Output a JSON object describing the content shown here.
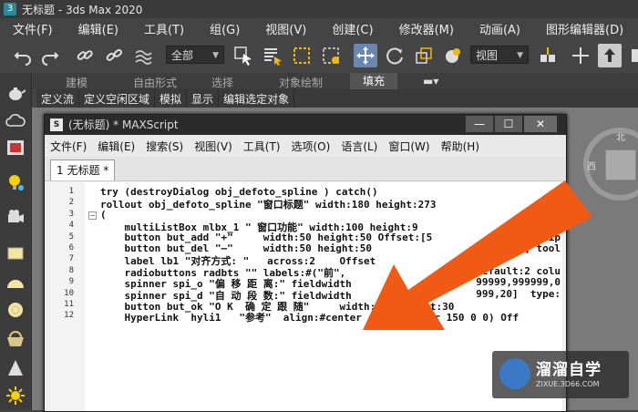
{
  "app": {
    "title": "无标题 - 3ds Max 2020",
    "logo_label": "3"
  },
  "main_menu": [
    "文件(F)",
    "编辑(E)",
    "工具(T)",
    "组(G)",
    "视图(V)",
    "创建(C)",
    "修改器(M)",
    "动画(A)",
    "图形编辑器(D)"
  ],
  "toolbar": {
    "selection_filter": "全部",
    "view_combo": "视图"
  },
  "ribbon": {
    "tabs": [
      "建模",
      "自由形式",
      "选择",
      "对象绘制",
      "填充"
    ],
    "active_tab": "填充",
    "sub_items": [
      "定义流",
      "定义空闲区域",
      "模拟",
      "显示",
      "编辑选定对象"
    ]
  },
  "viewcube": {
    "north": "北",
    "west": "西"
  },
  "maxscript": {
    "title": "(无标题) * MAXScript",
    "icon_label": "S",
    "window_buttons": [
      "—",
      "☐",
      "✕"
    ],
    "menu": [
      "文件(F)",
      "编辑(E)",
      "搜索(S)",
      "视图(V)",
      "工具(T)",
      "选项(O)",
      "语言(L)",
      "窗口(W)",
      "帮助(H)"
    ],
    "tab": "1 无标题 *",
    "lines": [
      {
        "num": "1",
        "code": "try (destroyDialog obj_defoto_spline ) catch()"
      },
      {
        "num": "2",
        "code": "rollout obj_defoto_spline \"窗口标题\" width:180 height:273"
      },
      {
        "num": "3",
        "code": "("
      },
      {
        "num": "4",
        "code": "    multiListBox mlbx_1 \" 窗口功能\" width:100 height:9"
      },
      {
        "num": "5",
        "code": "    button but_add \"+\"     width:50 height:50 Offset:[5"
      },
      {
        "num": "6",
        "code": "    button but_del \"—\"     width:50 height:50"
      },
      {
        "num": "7",
        "code": "    label lb1 \"对齐方式: \"   across:2    Offset"
      },
      {
        "num": "8",
        "code": "    radiobuttons radbts \"\" labels:#(\"前\","
      },
      {
        "num": "9",
        "code": "    spinner spi_o \"偏 移 距 离:\" fieldwidth"
      },
      {
        "num": "10",
        "code": "    spinner spi_d \"自 动 段 数:\" fieldwidth"
      },
      {
        "num": "11",
        "code": "    button but_ok \"O K  确 定 跟 随\"     width:150 height:30"
      },
      {
        "num": "12",
        "code": "    HyperLink  hyli1   \"参考\"  align:#center color:(color 150 0 0) Off"
      }
    ],
    "right_fragments": [
      {
        "line": 5,
        "text": "iltip"
      },
      {
        "line": 6,
        "text": "] tool"
      },
      {
        "line": 8,
        "text": "efault:2 colu"
      },
      {
        "line": 9,
        "text": "99999,999999,0"
      },
      {
        "line": 10,
        "text": "999,20]  type:"
      }
    ]
  },
  "watermark": {
    "title": "溜溜自学",
    "subtitle": "ZIXUE.3D66.COM"
  }
}
